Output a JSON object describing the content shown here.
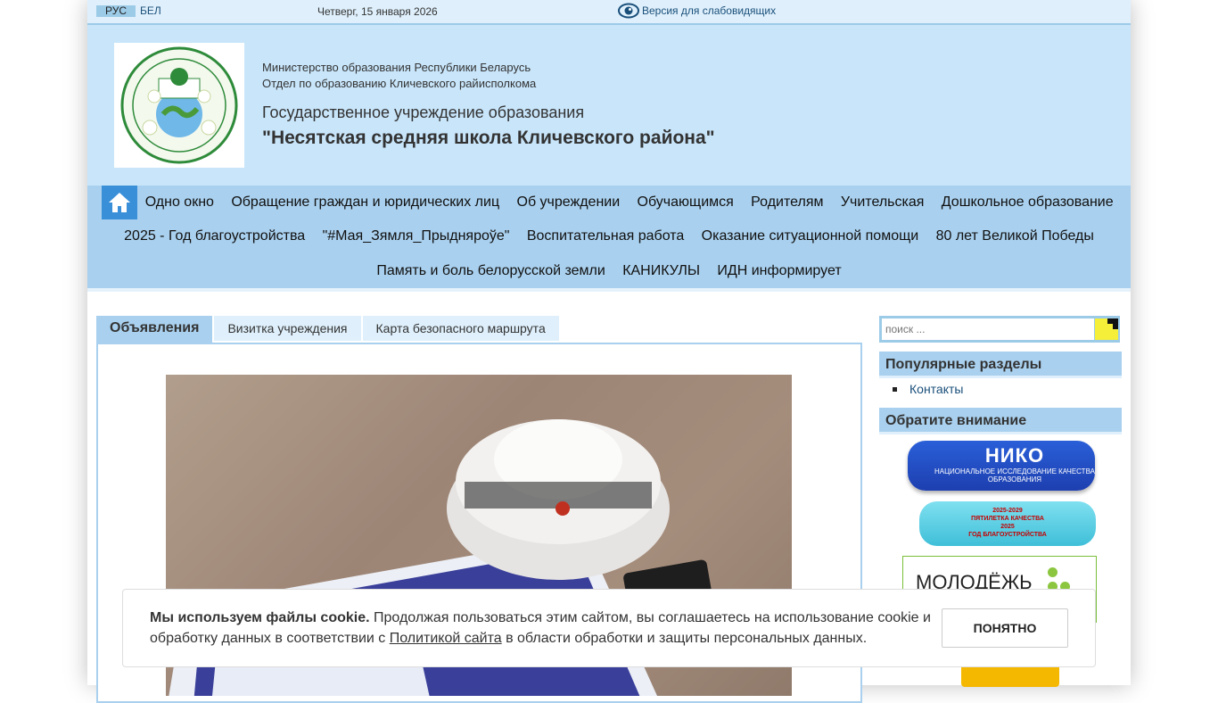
{
  "topbar": {
    "lang_rus": "РУС",
    "lang_bel": "БЕЛ",
    "date": "Четверг, 15 января 2026",
    "vision_link": "Версия для слабовидящих"
  },
  "header": {
    "ministry": "Министерство образования Республики Беларусь",
    "department": "Отдел по образованию Кличевского райисполкома",
    "institution": "Государственное учреждение образования",
    "school_name": "\"Несятская средняя школа Кличевского района\""
  },
  "nav": {
    "row1": [
      "Одно окно",
      "Обращение граждан и юридических лиц",
      "Об учреждении",
      "Обучающимся",
      "Родителям",
      "Учительская",
      "Дошкольное образование"
    ],
    "row2": [
      "2025 - Год благоустройства",
      "\"#Мая_Зямля_Прыдняроўе\"",
      "Воспитательная работа",
      "Оказание ситуационной помощи",
      "80 лет Великой Победы"
    ],
    "row3": [
      "Память и боль белорусской земли",
      "КАНИКУЛЫ",
      "ИДН информирует"
    ]
  },
  "tabs": [
    "Объявления",
    "Визитка учреждения",
    "Карта безопасного маршрута"
  ],
  "search": {
    "placeholder": "поиск ..."
  },
  "sidebar": {
    "popular_title": "Популярные разделы",
    "popular_items": [
      "Контакты"
    ],
    "attention_title": "Обратите внимание",
    "banner_niko_title": "НИКО",
    "banner_niko_sub": "НАЦИОНАЛЬНОЕ ИССЛЕДОВАНИЕ КАЧЕСТВА ОБРАЗОВАНИЯ",
    "banner_quality_line1": "2025-2029",
    "banner_quality_line2": "ПЯТИЛЕТКА КАЧЕСТВА",
    "banner_quality_line3": "2025",
    "banner_quality_line4": "ГОД БЛАГОУСТРОЙСТВА",
    "banner_youth": "МОЛОДЁЖЬ"
  },
  "cookie": {
    "bold": "Мы используем файлы cookie.",
    "text1": " Продолжая пользоваться этим сайтом, вы соглашаетесь на использование cookie и обработку данных в соответствии с ",
    "link": "Политикой сайта",
    "text2": " в области обработки и защиты персональных данных.",
    "button": "ПОНЯТНО"
  },
  "colors": {
    "header_bg": "#c8e5fa",
    "nav_bg": "#a9d0ee",
    "home_button": "#3a8fd9",
    "link": "#1a4f7a"
  }
}
